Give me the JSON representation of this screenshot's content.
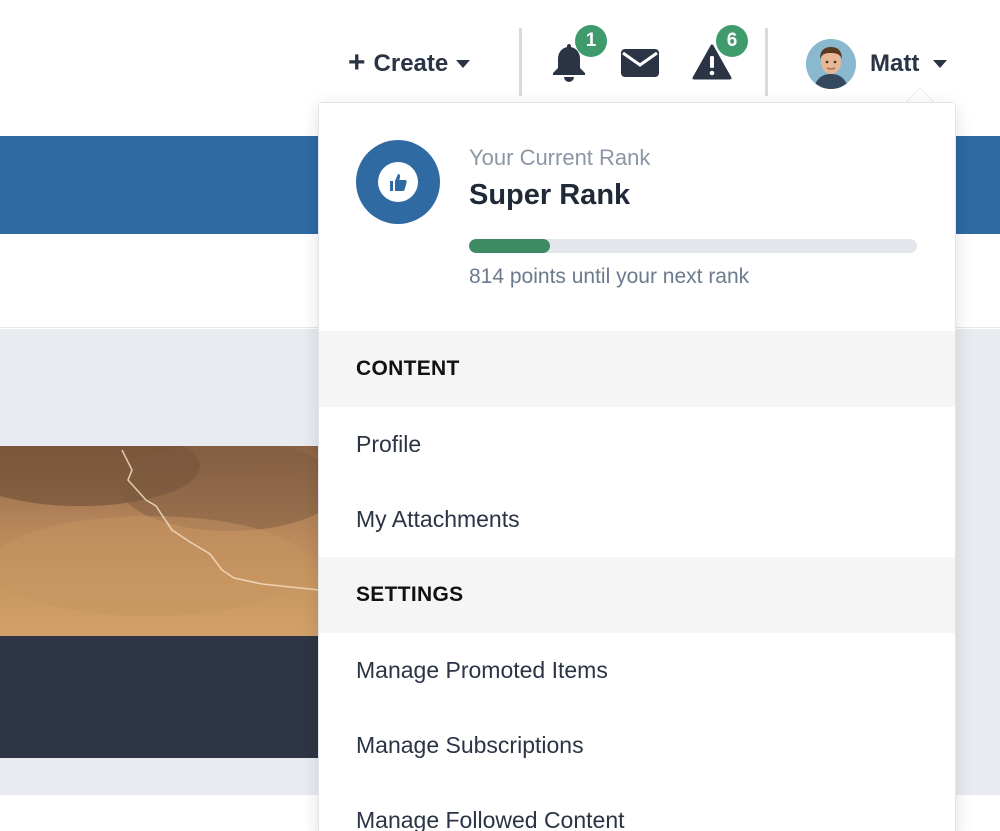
{
  "header": {
    "create_label": "Create",
    "notifications": {
      "icon": "bell-icon",
      "count": "1"
    },
    "messages": {
      "icon": "envelope-icon"
    },
    "reports": {
      "icon": "warning-icon",
      "count": "6"
    },
    "user": {
      "name": "Matt",
      "avatar": "user-avatar"
    }
  },
  "dropdown": {
    "rank": {
      "caption": "Your Current Rank",
      "title": "Super Rank",
      "progress": 0.18,
      "note": "814 points until your next rank",
      "badge_icon": "thumbs-up-icon"
    },
    "sections": [
      {
        "header": "CONTENT",
        "items": [
          "Profile",
          "My Attachments"
        ]
      },
      {
        "header": "SETTINGS",
        "items": [
          "Manage Promoted Items",
          "Manage Subscriptions",
          "Manage Followed Content"
        ]
      }
    ]
  },
  "colors": {
    "brand_blue": "#2f6aa3",
    "badge_green": "#3f9a6c",
    "progress_green": "#3e8a63",
    "text_dark": "#2a3445"
  }
}
